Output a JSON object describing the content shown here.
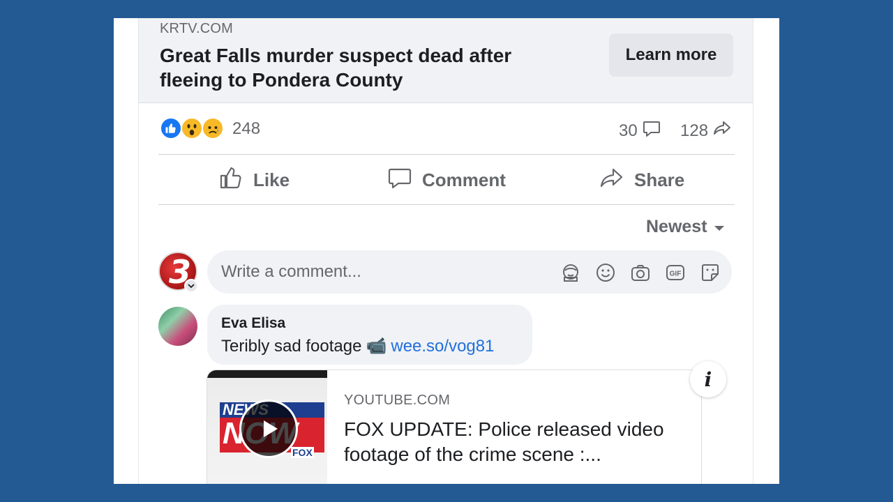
{
  "link_preview": {
    "domain": "KRTV.COM",
    "title": "Great Falls murder suspect dead after fleeing to Pondera County",
    "cta_label": "Learn more"
  },
  "stats": {
    "reaction_icons": [
      "like-icon",
      "wow-icon",
      "sad-icon"
    ],
    "reaction_count": "248",
    "comment_count": "30",
    "share_count": "128"
  },
  "actions": {
    "like_label": "Like",
    "comment_label": "Comment",
    "share_label": "Share"
  },
  "sort": {
    "label": "Newest"
  },
  "composer": {
    "placeholder": "Write a comment...",
    "avatar_text": "3",
    "tools": [
      "avatar-sticker-icon",
      "emoji-icon",
      "camera-icon",
      "gif-icon",
      "sticker-icon"
    ]
  },
  "comment": {
    "author": "Eva Elisa",
    "text": "Teribly sad footage",
    "emoji": "📹",
    "link": "wee.so/vog81"
  },
  "embed": {
    "domain": "YOUTUBE.COM",
    "title": "FOX UPDATE: Police released video footage of the crime scene :...",
    "thumb_text_top": "NEWS",
    "thumb_text_main": "NOW",
    "thumb_text_brand": "FOX",
    "info_label": "i"
  },
  "colors": {
    "background": "#245a93",
    "link": "#216fdb",
    "like_blue": "#1877f2",
    "secondary_text": "#65676b"
  }
}
